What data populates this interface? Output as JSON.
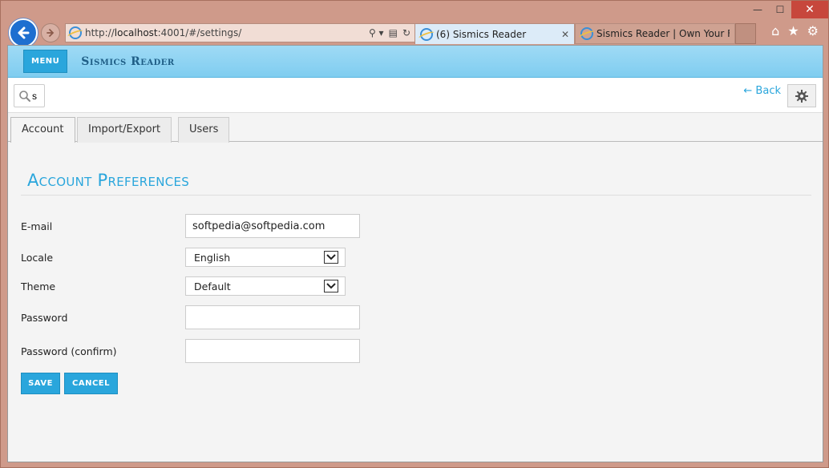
{
  "browser": {
    "address_protocol": "http://",
    "address_host": "localhost",
    "address_rest": ":4001/#/settings/",
    "tabs": [
      {
        "label": "(6) Sismics Reader"
      },
      {
        "label": "Sismics Reader | Own Your Fee..."
      }
    ]
  },
  "app": {
    "menu_label": "MENU",
    "brand": "Sismics Reader",
    "back_label": "← Back",
    "search_value": "s"
  },
  "settings_tabs": [
    {
      "label": "Account"
    },
    {
      "label": "Import/Export"
    },
    {
      "label": "Users"
    }
  ],
  "page": {
    "title": "Account Preferences",
    "fields": {
      "email_label": "E-mail",
      "email_value": "softpedia@softpedia.com",
      "locale_label": "Locale",
      "locale_value": "English",
      "theme_label": "Theme",
      "theme_value": "Default",
      "password_label": "Password",
      "password_confirm_label": "Password (confirm)"
    },
    "save_label": "SAVE",
    "cancel_label": "CANCEL"
  },
  "colors": {
    "accent": "#2aa6dc",
    "appbar": "#8fd4f3"
  }
}
